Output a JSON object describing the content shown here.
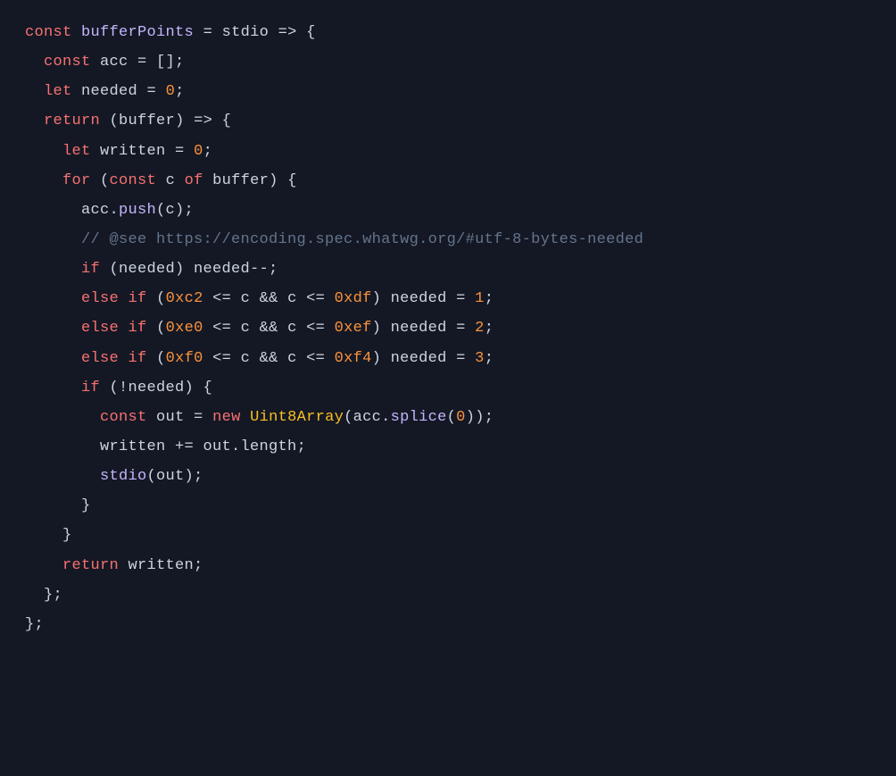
{
  "code": {
    "l1": {
      "kw1": "const",
      "fn": "bufferPoints",
      "op1": " = ",
      "id": "stdio",
      "op2": " => {"
    },
    "l2": {
      "indent": "  ",
      "kw": "const",
      "id": " acc ",
      "op": "= [];"
    },
    "l3": {
      "indent": "  ",
      "kw": "let",
      "id": " needed ",
      "op1": "= ",
      "num": "0",
      "op2": ";"
    },
    "l4": {
      "indent": "  ",
      "kw": "return",
      "op1": " (",
      "id": "buffer",
      "op2": ") => {"
    },
    "l5": {
      "indent": "    ",
      "kw": "let",
      "id": " written ",
      "op1": "= ",
      "num": "0",
      "op2": ";"
    },
    "l6": {
      "indent": "    ",
      "kw1": "for",
      "op1": " (",
      "kw2": "const",
      "id1": " c ",
      "kw3": "of",
      "id2": " buffer",
      "op2": ") {"
    },
    "l7": {
      "indent": "      ",
      "id": "acc.",
      "fn": "push",
      "op": "(c);"
    },
    "l8": {
      "indent": "      ",
      "cmt": "// @see https://encoding.spec.whatwg.org/#utf-8-bytes-needed"
    },
    "l9": {
      "indent": "      ",
      "kw": "if",
      "op": " (needed) needed--;"
    },
    "l10": {
      "indent": "      ",
      "kw1": "else",
      "sp": " ",
      "kw2": "if",
      "op1": " (",
      "num1": "0xc2",
      "op2": " <= c && c <= ",
      "num2": "0xdf",
      "op3": ") needed = ",
      "num3": "1",
      "op4": ";"
    },
    "l11": {
      "indent": "      ",
      "kw1": "else",
      "sp": " ",
      "kw2": "if",
      "op1": " (",
      "num1": "0xe0",
      "op2": " <= c && c <= ",
      "num2": "0xef",
      "op3": ") needed = ",
      "num3": "2",
      "op4": ";"
    },
    "l12": {
      "indent": "      ",
      "kw1": "else",
      "sp": " ",
      "kw2": "if",
      "op1": " (",
      "num1": "0xf0",
      "op2": " <= c && c <= ",
      "num2": "0xf4",
      "op3": ") needed = ",
      "num3": "3",
      "op4": ";"
    },
    "l13": {
      "indent": "      ",
      "kw": "if",
      "op": " (!needed) {"
    },
    "l14": {
      "indent": "        ",
      "kw1": "const",
      "id": " out ",
      "op1": "= ",
      "kw2": "new",
      "sp": " ",
      "cls": "Uint8Array",
      "op2": "(acc.",
      "fn": "splice",
      "op3": "(",
      "num": "0",
      "op4": "));"
    },
    "l15": {
      "indent": "        ",
      "op1": "written += out.",
      "id": "length",
      "op2": ";"
    },
    "l16": {
      "indent": "        ",
      "fn": "stdio",
      "op": "(out);"
    },
    "l17": {
      "indent": "      ",
      "op": "}"
    },
    "l18": {
      "indent": "    ",
      "op": "}"
    },
    "l19": {
      "indent": "    ",
      "kw": "return",
      "id": " written",
      "op": ";"
    },
    "l20": {
      "indent": "  ",
      "op": "};"
    },
    "l21": {
      "op": "};"
    }
  }
}
